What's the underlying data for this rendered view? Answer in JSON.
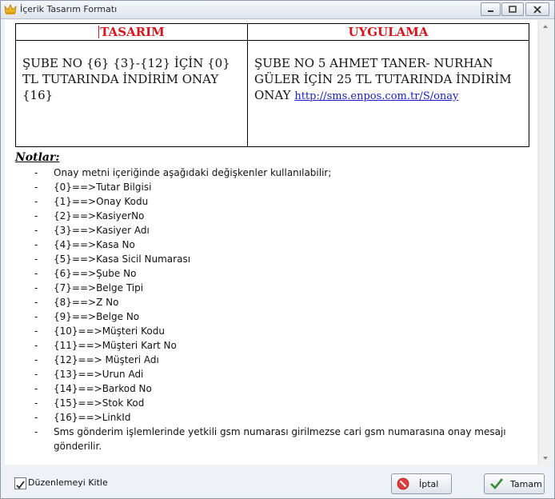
{
  "window": {
    "title": "İçerik Tasarım Formatı",
    "icon": "crown-icon",
    "controls": [
      "minimize-icon",
      "maximize-icon",
      "close-icon"
    ]
  },
  "format_table": {
    "headers": [
      "TASARIM",
      "UYGULAMA"
    ],
    "design_text": "ŞUBE NO {6} {3}-{12} İÇİN {0} TL TUTARINDA İNDİRİM ONAY {16}",
    "application_text": "ŞUBE NO 5 AHMET TANER- NURHAN GÜLER İÇİN 25 TL TUTARINDA İNDİRİM ONAY ",
    "application_link": "http://sms.enpos.com.tr/S/onay",
    "header_color": "#e0121b"
  },
  "notes": {
    "title": "Notlar:",
    "bullet": "-",
    "items": [
      "Onay metni içeriğinde aşağıdaki değişkenler kullanılabilir;",
      "{0}==>Tutar Bilgisi",
      "{1}==>Onay Kodu",
      "{2}==>KasiyerNo",
      "{3}==>Kasiyer Adı",
      "{4}==>Kasa No",
      "{5}==>Kasa Sicil Numarası",
      "{6}==>Şube No",
      "{7}==>Belge Tipi",
      "{8}==>Z No",
      "{9}==>Belge No",
      "{10}==>Müşteri Kodu",
      "{11}==>Müşteri Kart No",
      "{12}==> Müşteri Adı",
      "{13}==>Urun Adi",
      "{14}==>Barkod No",
      "{15}==>Stok Kod",
      "{16}==>LinkId",
      "Sms gönderim işlemlerinde yetkili gsm numarası girilmezse cari gsm numarasına onay mesajı gönderilir."
    ]
  },
  "footer": {
    "lock_checkbox_label": "Düzenlemeyi Kitle",
    "lock_checked": true,
    "cancel_label": "İptal",
    "cancel_icon": "cancel-icon",
    "ok_label": "Tamam",
    "ok_icon": "checkmark-icon"
  }
}
